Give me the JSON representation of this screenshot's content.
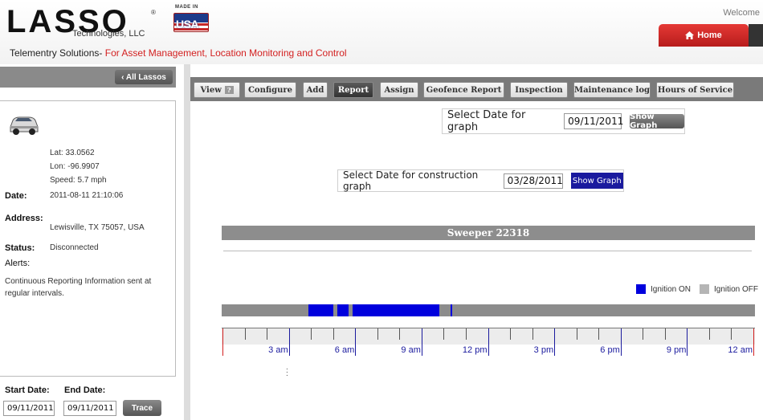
{
  "header": {
    "logo_text": "LASSO",
    "logo_sub": "Technologies, LLC",
    "made_in": "MADE IN",
    "flag_text": "USA",
    "tagline_prefix": "Telementry Solutions-",
    "tagline_highlight": "For Asset Management, Location Monitoring and Control",
    "welcome": "Welcome",
    "home_label": "Home"
  },
  "sidebar": {
    "all_lassos": "‹ All Lassos",
    "lat": "Lat: 33.0562",
    "lon": "Lon: -96.9907",
    "speed": "Speed: 5.7 mph",
    "date_label": "Date:",
    "date_value": "2011-08-11 21:10:06",
    "address_label": "Address:",
    "address_value": "Lewisville, TX 75057, USA",
    "status_label": "Status:",
    "status_value": "Disconnected",
    "alerts_label": "Alerts:",
    "alerts_value": "Continuous Reporting Information sent at regular intervals.",
    "start_date_label": "Start Date:",
    "end_date_label": "End Date:",
    "start_date_value": "09/11/2011",
    "end_date_value": "09/11/2011",
    "trace_label": "Trace"
  },
  "tabs": [
    {
      "label": "View",
      "badge": "?"
    },
    {
      "label": "Configure"
    },
    {
      "label": "Add"
    },
    {
      "label": "Report"
    },
    {
      "label": "Assign"
    },
    {
      "label": "Geofence Report"
    },
    {
      "label": "Inspection"
    },
    {
      "label": "Maintenance log"
    },
    {
      "label": "Hours of Service"
    }
  ],
  "graph_date": {
    "label": "Select Date for graph",
    "value": "09/11/2011",
    "button": "Show Graph"
  },
  "construction_date": {
    "label": "Select Date for construction graph",
    "value": "03/28/2011",
    "button": "Show Graph"
  },
  "graph": {
    "title": "Sweeper 22318",
    "legend_on": "Ignition ON",
    "legend_off": "Ignition OFF",
    "on_color": "#0000dd",
    "off_color": "#b5b5b5",
    "time_labels": [
      "3 am",
      "6 am",
      "9 am",
      "12 pm",
      "3 pm",
      "6 pm",
      "9 pm",
      "12 am"
    ]
  },
  "chart_data": {
    "type": "bar",
    "title": "Sweeper 22318",
    "x_range_hours": [
      0,
      24
    ],
    "tick_labels": [
      "3 am",
      "6 am",
      "9 am",
      "12 pm",
      "3 pm",
      "6 pm",
      "9 pm",
      "12 am"
    ],
    "series": [
      {
        "name": "Ignition ON",
        "intervals_hours": [
          [
            3.9,
            5.0
          ],
          [
            5.2,
            5.7
          ],
          [
            5.9,
            9.8
          ],
          [
            10.3,
            10.4
          ]
        ]
      }
    ]
  }
}
